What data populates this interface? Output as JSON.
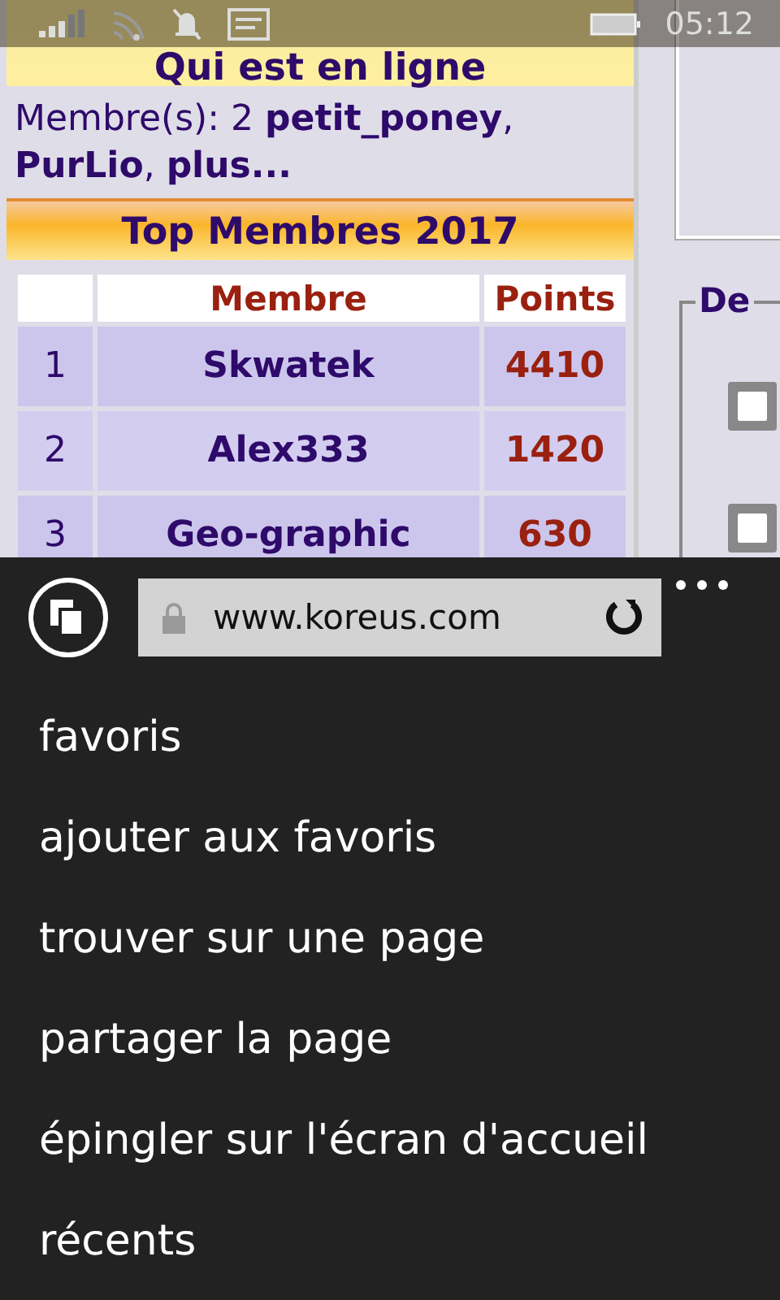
{
  "status_bar": {
    "time": "05:12"
  },
  "web_page": {
    "online_title": "Qui est en ligne",
    "online_text": "Membre(s): 2 **petit_poney**, **PurLio**, **plus...**",
    "top_title": "Top Membres 2017",
    "columns": [
      "Membre",
      "Points"
    ],
    "rows": [
      {
        "rank": "1",
        "member": "Skwatek",
        "points": "4410"
      },
      {
        "rank": "2",
        "member": "Alex333",
        "points": "1420"
      },
      {
        "rank": "3",
        "member": "Geo-graphic",
        "points": "630"
      }
    ],
    "side_legend": "De"
  },
  "browser": {
    "url": "www.koreus.com",
    "menu": [
      "favoris",
      "ajouter aux favoris",
      "trouver sur une page",
      "partager la page",
      "épingler sur l'écran d'accueil",
      "récents"
    ]
  }
}
